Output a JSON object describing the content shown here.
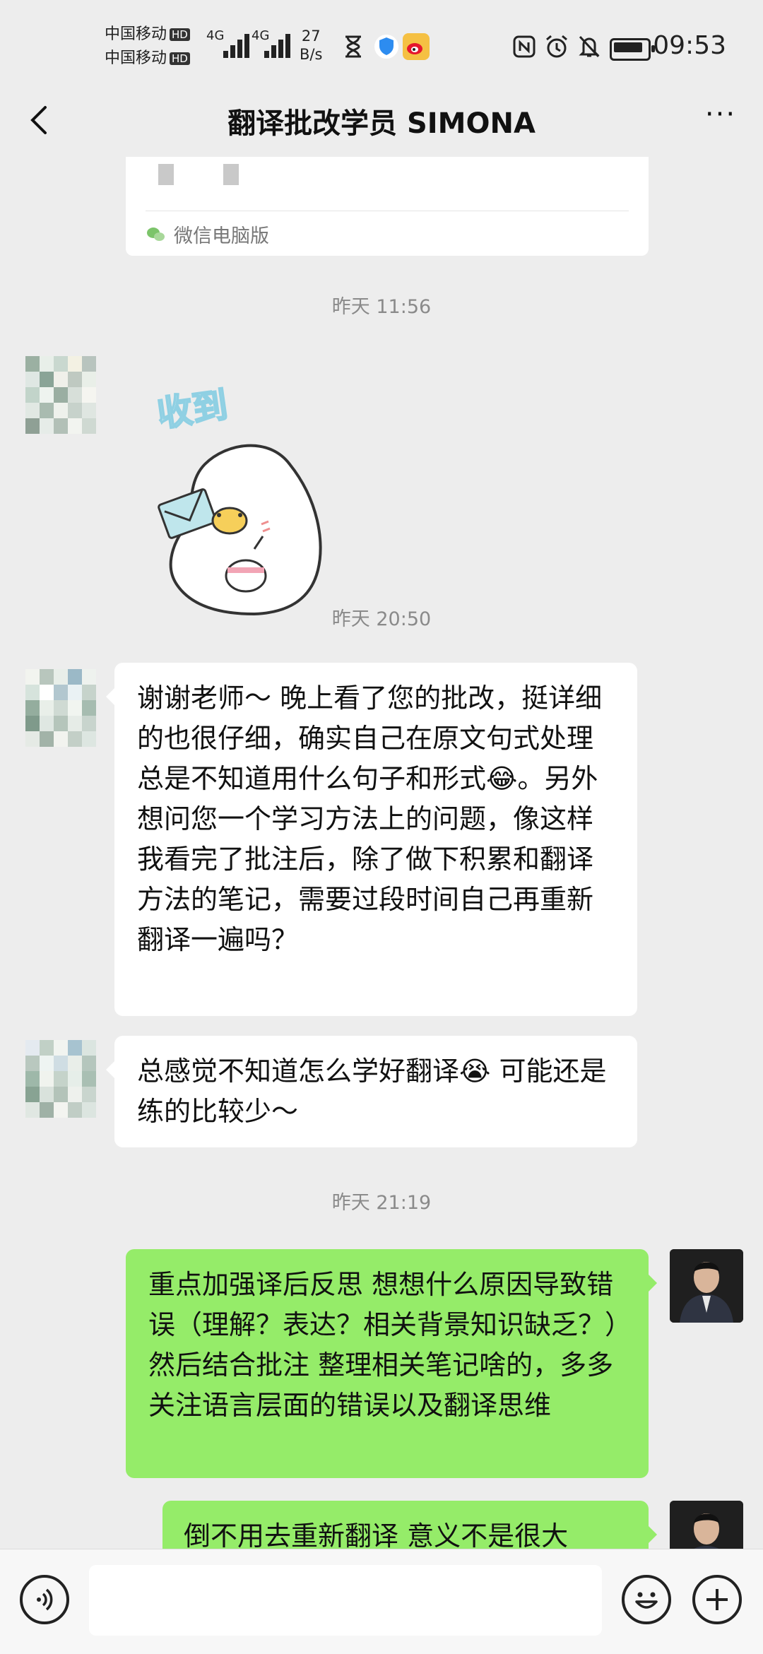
{
  "status_bar": {
    "carrier_1": "中国移动",
    "carrier_2": "中国移动",
    "hd_badge": "HD",
    "network_1": "4G",
    "network_2": "4G",
    "speed_value": "27",
    "speed_unit": "B/s",
    "time": "09:53",
    "icons": [
      "hourglass-icon",
      "shield-icon",
      "weibo-icon",
      "nfc-icon",
      "alarm-icon",
      "mute-bell-icon",
      "battery-icon"
    ]
  },
  "header": {
    "title": "翻译批改学员 SIMONA",
    "more_label": "···"
  },
  "chat": {
    "card_footer": "微信电脑版",
    "timestamps": [
      "昨天 11:56",
      "昨天 20:50",
      "昨天 21:19"
    ],
    "sticker_text": "收到",
    "messages": [
      {
        "direction": "in",
        "text": "谢谢老师～ 晚上看了您的批改，挺详细的也很仔细，确实自己在原文句式处理总是不知道用什么句子和形式😂。另外想问您一个学习方法上的问题，像这样我看完了批注后，除了做下积累和翻译方法的笔记，需要过段时间自己再重新翻译一遍吗？"
      },
      {
        "direction": "in",
        "text": "总感觉不知道怎么学好翻译😭 可能还是练的比较少～"
      },
      {
        "direction": "out",
        "text": "重点加强译后反思 想想什么原因导致错误（理解？表达？相关背景知识缺乏？）然后结合批注 整理相关笔记啥的，多多关注语言层面的错误以及翻译思维"
      },
      {
        "direction": "out",
        "text": "倒不用去重新翻译 意义不是很大"
      }
    ]
  },
  "input_bar": {
    "placeholder": ""
  },
  "colors": {
    "background": "#ededed",
    "bubble_in": "#ffffff",
    "bubble_out": "#95ec69",
    "timestamp": "#8a8a8a"
  }
}
